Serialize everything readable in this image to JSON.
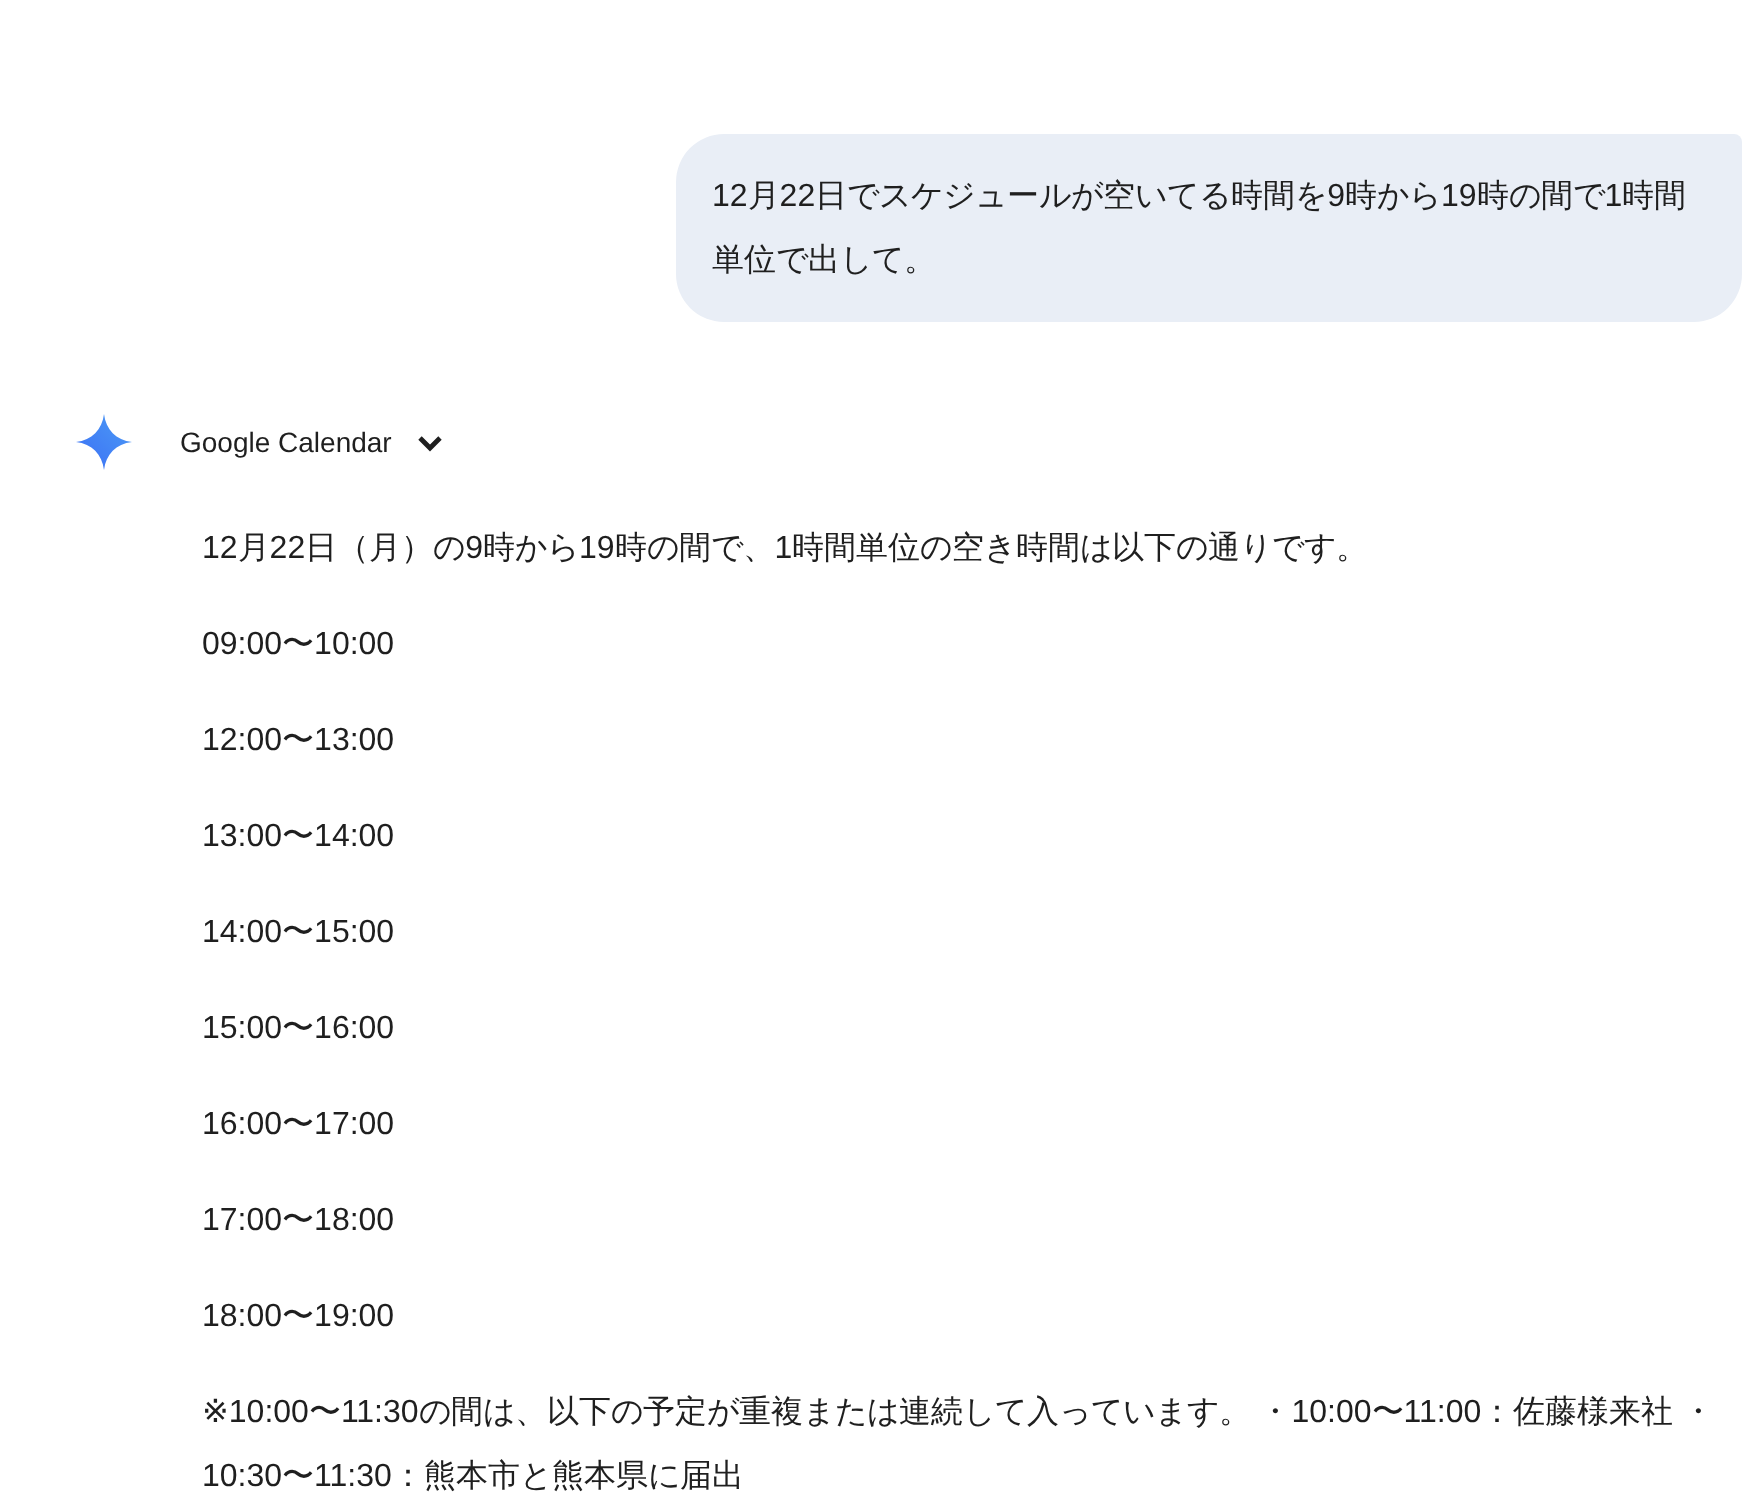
{
  "user_message": "12月22日でスケジュールが空いてる時間を9時から19時の間で1時間単位で出して。",
  "response": {
    "source": {
      "label": "Google Calendar",
      "expanded": false
    },
    "intro": "12月22日（月）の9時から19時の間で、1時間単位の空き時間は以下の通りです。",
    "slots": [
      "09:00〜10:00",
      "12:00〜13:00",
      "13:00〜14:00",
      "14:00〜15:00",
      "15:00〜16:00",
      "16:00〜17:00",
      "17:00〜18:00",
      "18:00〜19:00"
    ],
    "note": "※10:00〜11:30の間は、以下の予定が重複または連続して入っています。 ・10:00〜11:00：佐藤様来社 ・10:30〜11:30：熊本市と熊本県に届出"
  }
}
